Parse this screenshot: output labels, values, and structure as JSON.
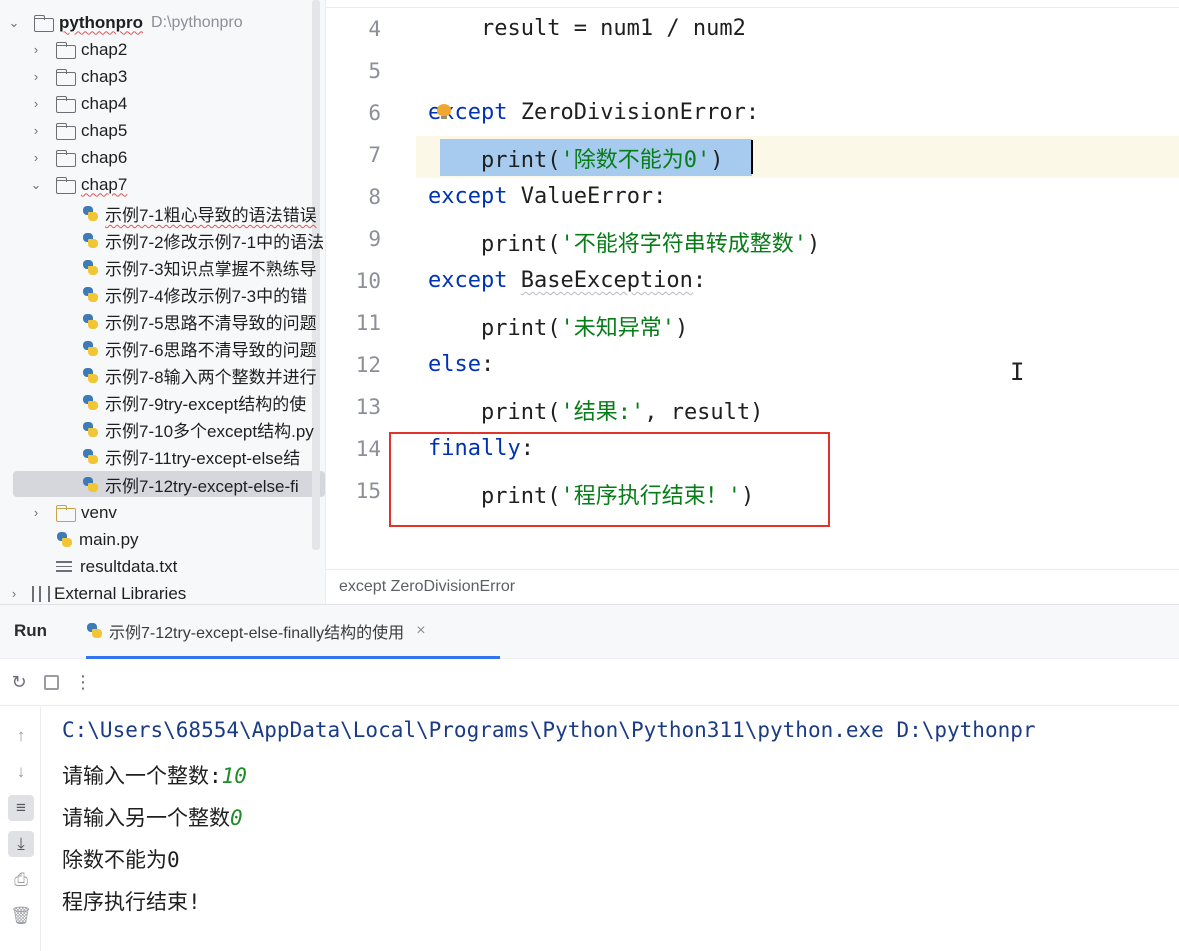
{
  "tree": {
    "root_name": "pythonpro",
    "root_path": "D:\\pythonpro",
    "folders": [
      "chap2",
      "chap3",
      "chap4",
      "chap5",
      "chap6"
    ],
    "open_folder": "chap7",
    "files": [
      "示例7-1粗心导致的语法错误",
      "示例7-2修改示例7-1中的语法",
      "示例7-3知识点掌握不熟练导",
      "示例7-4修改示例7-3中的错",
      "示例7-5思路不清导致的问题",
      "示例7-6思路不清导致的问题",
      "示例7-8输入两个整数并进行",
      "示例7-9try-except结构的使",
      "示例7-10多个except结构.py",
      "示例7-11try-except-else结",
      "示例7-12try-except-else-fi"
    ],
    "venv": "venv",
    "main_file": "main.py",
    "result_file": "resultdata.txt",
    "external": "External Libraries"
  },
  "editor": {
    "line_numbers": [
      "4",
      "5",
      "6",
      "7",
      "8",
      "9",
      "10",
      "11",
      "12",
      "13",
      "14",
      "15"
    ],
    "l4": "    result = num1 / num2",
    "l6_kw": "except",
    "l6_rest": " ZeroDivisionError:",
    "l7_fn": "    print(",
    "l7_str": "'除数不能为0'",
    "l7_end": ")",
    "l8_kw": "except",
    "l8_rest": " ValueError:",
    "l9_fn": "    print(",
    "l9_str": "'不能将字符串转成整数'",
    "l9_end": ")",
    "l10_kw": "except",
    "l10_cls": "BaseException",
    "l10_end": ":",
    "l11_fn": "    print(",
    "l11_str": "'未知异常'",
    "l11_end": ")",
    "l12_kw": "else",
    "l12_end": ":",
    "l13_fn": "    print(",
    "l13_str": "'结果:'",
    "l13_end": ", result)",
    "l14_kw": "finally",
    "l14_end": ":",
    "l15_fn": "    print(",
    "l15_str": "'程序执行结束！'",
    "l15_end": ")",
    "breadcrumb": "except ZeroDivisionError"
  },
  "run": {
    "title": "Run",
    "tab_label": "示例7-12try-except-else-finally结构的使用",
    "tab_close": "×",
    "console": {
      "command": "C:\\Users\\68554\\AppData\\Local\\Programs\\Python\\Python311\\python.exe D:\\pythonpr",
      "prompt1": "请输入一个整数:",
      "input1": "10",
      "prompt2": "请输入另一个整数",
      "input2": "0",
      "out1": "除数不能为0",
      "out2": "程序执行结束!"
    }
  }
}
